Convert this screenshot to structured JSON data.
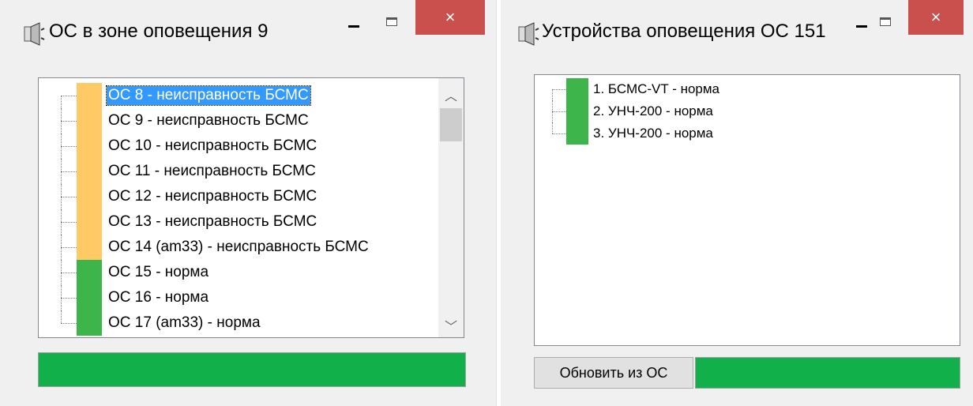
{
  "colors": {
    "warning": "#ffca66",
    "normal": "#3db54a",
    "status": "#11b04b",
    "close": "#c9504c",
    "selection": "#3399ff"
  },
  "window1": {
    "title": "ОС в зоне оповещения 9",
    "icon": "loudspeaker-icon",
    "items": [
      {
        "label": "ОС 8 - неисправность БСМС",
        "state": "warning",
        "selected": true
      },
      {
        "label": "ОС 9 - неисправность БСМС",
        "state": "warning"
      },
      {
        "label": "ОС 10 - неисправность БСМС",
        "state": "warning"
      },
      {
        "label": "ОС 11 - неисправность БСМС",
        "state": "warning"
      },
      {
        "label": "ОС 12 - неисправность БСМС",
        "state": "warning"
      },
      {
        "label": "ОС 13 - неисправность БСМС",
        "state": "warning"
      },
      {
        "label": "ОС 14 (am33) - неисправность БСМС",
        "state": "warning"
      },
      {
        "label": "ОС 15 - норма",
        "state": "normal"
      },
      {
        "label": "ОС 16 - норма",
        "state": "normal"
      },
      {
        "label": "ОС 17 (am33) - норма",
        "state": "normal"
      }
    ]
  },
  "window2": {
    "title": "Устройства оповещения ОС 151",
    "icon": "loudspeaker-icon",
    "items": [
      {
        "label": "1. БСМС-VT - норма",
        "state": "normal"
      },
      {
        "label": "2. УНЧ-200 - норма",
        "state": "normal"
      },
      {
        "label": "3. УНЧ-200 - норма",
        "state": "normal"
      }
    ],
    "refresh_label": "Обновить из ОС"
  },
  "controls": {
    "minimize": "minimize-icon",
    "maximize": "maximize-icon",
    "close_glyph": "×"
  }
}
